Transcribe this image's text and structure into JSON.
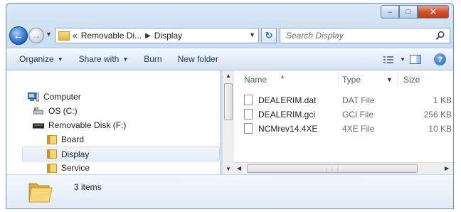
{
  "window": {
    "caption": {
      "minimize": "–",
      "maximize": "□",
      "close": "✕"
    }
  },
  "address": {
    "overflow": "«",
    "breadcrumbs": [
      "Removable Di...",
      "Display"
    ],
    "search_placeholder": "Search Display"
  },
  "toolbar": {
    "organize": "Organize",
    "share_with": "Share with",
    "burn": "Burn",
    "new_folder": "New folder",
    "help": "?"
  },
  "nav": {
    "items": [
      {
        "label": "Computer",
        "icon": "computer-icon"
      },
      {
        "label": "OS (C:)",
        "icon": "drive-c-icon"
      },
      {
        "label": "Removable Disk (F:)",
        "icon": "removable-drive-icon"
      },
      {
        "label": "Board",
        "icon": "folder-icon"
      },
      {
        "label": "Display",
        "icon": "folder-icon",
        "selected": true
      },
      {
        "label": "Service",
        "icon": "folder-icon"
      }
    ]
  },
  "files": {
    "columns": {
      "name": "Name",
      "type": "Type",
      "size": "Size"
    },
    "rows": [
      {
        "name": "DEALERIM.dat",
        "type": "DAT File",
        "size": "1 KB"
      },
      {
        "name": "DEALERIM.gci",
        "type": "GCI File",
        "size": "256 KB"
      },
      {
        "name": "NCMrev14.4XE",
        "type": "4XE File",
        "size": "10 KB"
      }
    ]
  },
  "details": {
    "count": "3 items"
  },
  "colors": {
    "chrome": "#c9dcf1",
    "toolbar_text": "#1e395b",
    "selection": "#e4ecf6",
    "folder": "#f5d67a"
  }
}
